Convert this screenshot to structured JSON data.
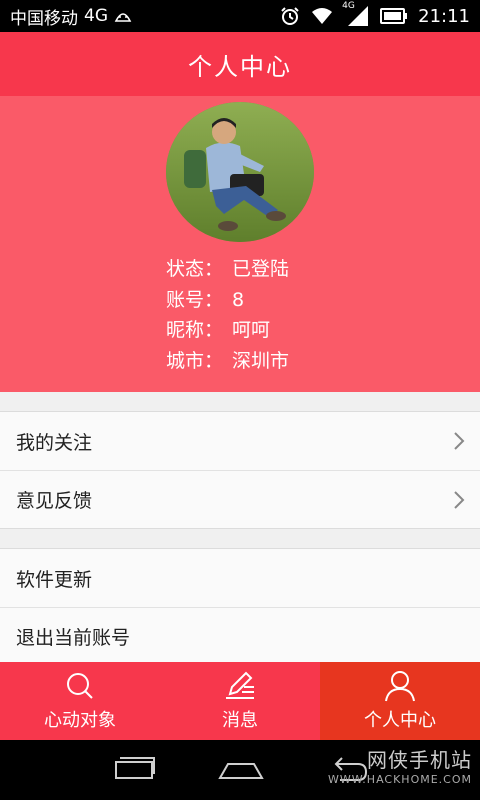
{
  "status_bar": {
    "carrier": "中国移动",
    "network": "4G",
    "net_indicator": "4G",
    "time": "21:11",
    "icons": [
      "android-icon",
      "alarm-icon",
      "wifi-icon",
      "signal-icon",
      "battery-icon"
    ]
  },
  "header": {
    "title": "个人中心"
  },
  "profile": {
    "rows": [
      {
        "key": "状态：",
        "value": "已登陆"
      },
      {
        "key": "账号：",
        "value": "8"
      },
      {
        "key": "昵称：",
        "value": "呵呵"
      },
      {
        "key": "城市：",
        "value": "深圳市"
      }
    ]
  },
  "menu": {
    "group1": [
      {
        "label": "我的关注"
      },
      {
        "label": "意见反馈"
      }
    ],
    "group2": [
      {
        "label": "软件更新"
      },
      {
        "label": "退出当前账号"
      }
    ]
  },
  "tabs": [
    {
      "label": "心动对象",
      "icon": "search-icon",
      "active": false
    },
    {
      "label": "消息",
      "icon": "edit-icon",
      "active": false
    },
    {
      "label": "个人中心",
      "icon": "user-icon",
      "active": true
    }
  ],
  "watermark": {
    "main": "网侠手机站",
    "sub": "WWW.HACKHOME.COM"
  },
  "colors": {
    "header": "#f7374c",
    "profile_bg": "#fa5a68",
    "active_tab": "#e7361f"
  }
}
